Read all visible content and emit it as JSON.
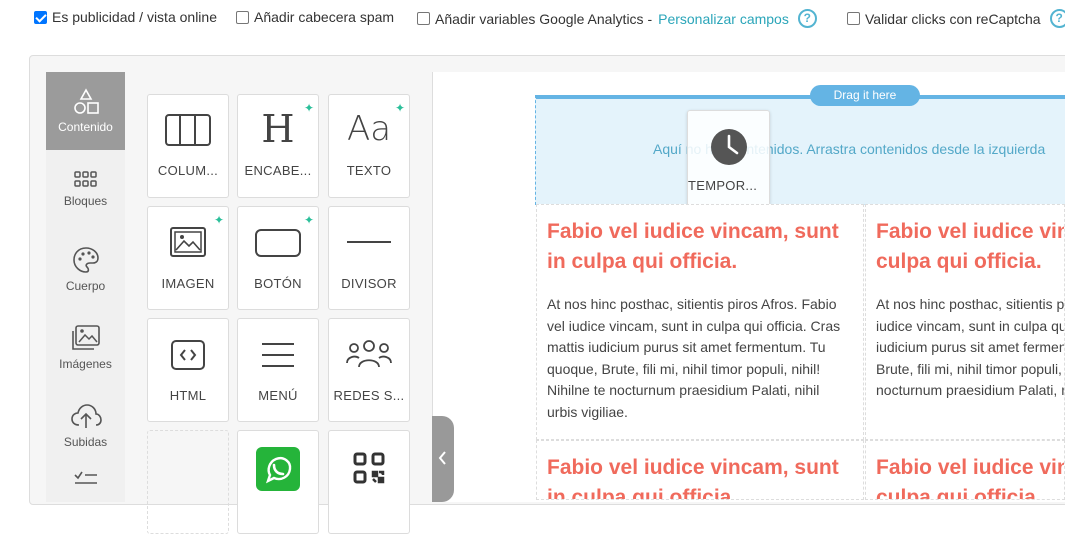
{
  "options": {
    "publicidad": {
      "label": "Es publicidad / vista online",
      "checked": true
    },
    "spam": {
      "label": "Añadir cabecera spam",
      "checked": false
    },
    "analytics": {
      "label": "Añadir variables Google Analytics -",
      "link": "Personalizar campos",
      "checked": false
    },
    "recaptcha": {
      "label": "Validar clicks con reCaptcha",
      "checked": false
    },
    "help_glyph": "?"
  },
  "sidebar": {
    "items": [
      {
        "label": "Contenido",
        "icon": "shapes-icon",
        "active": true
      },
      {
        "label": "Bloques",
        "icon": "grid-icon"
      },
      {
        "label": "Cuerpo",
        "icon": "palette-icon"
      },
      {
        "label": "Imágenes",
        "icon": "images-icon"
      },
      {
        "label": "Subidas",
        "icon": "cloud-upload-icon"
      }
    ]
  },
  "tiles": [
    {
      "label": "COLUM...",
      "icon": "columns-icon",
      "ai": false
    },
    {
      "label": "ENCABE...",
      "icon": "heading-icon",
      "glyph": "H",
      "ai": true
    },
    {
      "label": "TEXTO",
      "icon": "text-icon",
      "glyph": "Aa",
      "ai": true
    },
    {
      "label": "IMAGEN",
      "icon": "image-icon",
      "ai": true
    },
    {
      "label": "BOTÓN",
      "icon": "button-icon",
      "ai": true
    },
    {
      "label": "DIVISOR",
      "icon": "divider-icon",
      "ai": false
    },
    {
      "label": "HTML",
      "icon": "html-icon",
      "ai": false
    },
    {
      "label": "MENÚ",
      "icon": "menu-icon",
      "ai": false
    },
    {
      "label": "REDES S...",
      "icon": "social-icon",
      "ai": false
    }
  ],
  "canvas": {
    "drag_pill": "Drag it here",
    "drop_text": "Aquí no hay contenidos. Arrastra contenidos desde la izquierda",
    "ghost_label": "TEMPOR...",
    "heading": "Fabio vel iudice vincam, sunt in culpa qui officia.",
    "body": "At nos hinc posthac, sitientis piros Afros. Fabio vel iudice vincam, sunt in culpa qui officia. Cras mattis iudicium purus sit amet fermentum. Tu quoque, Brute, fili mi, nihil timor populi, nihil! Nihilne te nocturnum praesidium Palati, nihil urbis vigiliae."
  },
  "colors": {
    "accent": "#2aa5b9",
    "heading": "#f06a5c",
    "drop": "#64b4e4",
    "whatsapp": "#25b43a"
  }
}
